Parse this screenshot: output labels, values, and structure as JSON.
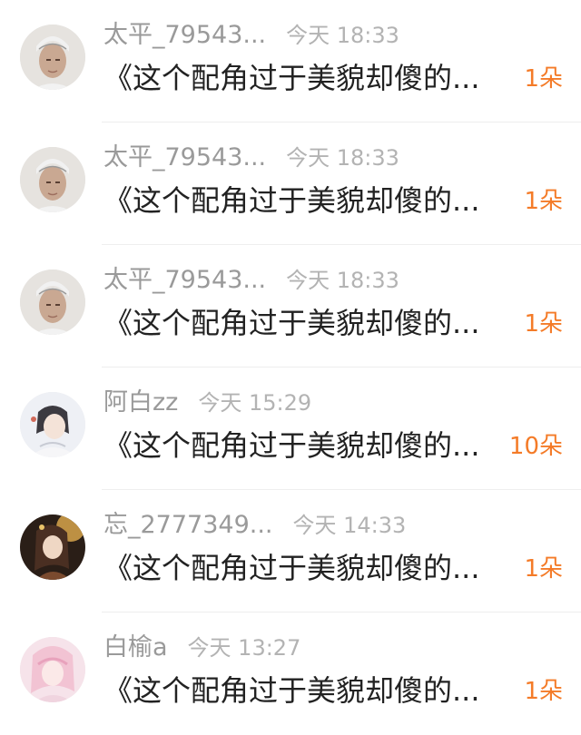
{
  "items": [
    {
      "username": "太平_79543...",
      "time": "今天 18:33",
      "title": "《这个配角过于美貌却傻的...",
      "count": "1朵",
      "avatar": "photo-avatar"
    },
    {
      "username": "太平_79543...",
      "time": "今天 18:33",
      "title": "《这个配角过于美貌却傻的...",
      "count": "1朵",
      "avatar": "photo-avatar"
    },
    {
      "username": "太平_79543...",
      "time": "今天 18:33",
      "title": "《这个配角过于美貌却傻的...",
      "count": "1朵",
      "avatar": "photo-avatar"
    },
    {
      "username": "阿白zz",
      "time": "今天 15:29",
      "title": "《这个配角过于美貌却傻的...",
      "count": "10朵",
      "avatar": "anime-avatar-white"
    },
    {
      "username": "忘_2777349...",
      "time": "今天 14:33",
      "title": "《这个配角过于美貌却傻的...",
      "count": "1朵",
      "avatar": "anime-avatar-dark"
    },
    {
      "username": "白榆a",
      "time": "今天 13:27",
      "title": "《这个配角过于美貌却傻的...",
      "count": "1朵",
      "avatar": "anime-avatar-pink"
    }
  ],
  "colors": {
    "accent": "#f47b28",
    "username": "#9a9a9a",
    "time": "#b3b3b3",
    "title": "#222222",
    "divider": "#eeeeee"
  }
}
